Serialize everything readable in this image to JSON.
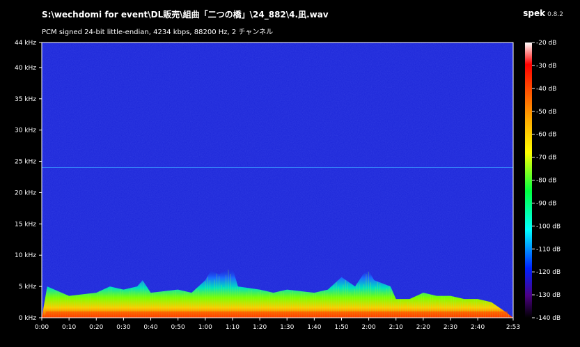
{
  "window": {
    "file_path": "S:\\wechdomi for event\\DL販売\\組曲「二つの橋」\\24_882\\4.凪.wav",
    "app_name": "spek",
    "app_version": "0.8.2",
    "file_info": "PCM signed 24-bit little-endian, 4234 kbps, 88200 Hz, 2 チャンネル"
  },
  "colors": {
    "background": "#000000",
    "spectrogram_base": "#1a24d8",
    "axis": "#ffffff",
    "scale": [
      "#ffffff",
      "#ff0000",
      "#ffa500",
      "#ffff00",
      "#00ff00",
      "#00ffff",
      "#0000ff",
      "#4b0082",
      "#000000"
    ]
  },
  "chart_data": {
    "type": "heatmap",
    "y_axis": {
      "unit": "kHz",
      "range": [
        0,
        44
      ],
      "ticks": [
        "0 kHz",
        "5 kHz",
        "10 kHz",
        "15 kHz",
        "20 kHz",
        "25 kHz",
        "30 kHz",
        "35 kHz",
        "40 kHz",
        "44 kHz"
      ],
      "tick_values": [
        0,
        5,
        10,
        15,
        20,
        25,
        30,
        35,
        40,
        44
      ]
    },
    "x_axis": {
      "unit": "time",
      "range_seconds": [
        0,
        173
      ],
      "ticks": [
        "0:00",
        "0:10",
        "0:20",
        "0:30",
        "0:40",
        "0:50",
        "1:00",
        "1:10",
        "1:20",
        "1:30",
        "1:40",
        "1:50",
        "2:00",
        "2:10",
        "2:20",
        "2:30",
        "2:40",
        "2:53"
      ],
      "tick_values": [
        0,
        10,
        20,
        30,
        40,
        50,
        60,
        70,
        80,
        90,
        100,
        110,
        120,
        130,
        140,
        150,
        160,
        173
      ]
    },
    "color_scale": {
      "unit": "dB",
      "range": [
        -140,
        -20
      ],
      "ticks": [
        "-20 dB",
        "-30 dB",
        "-40 dB",
        "-50 dB",
        "-60 dB",
        "-70 dB",
        "-80 dB",
        "-90 dB",
        "-100 dB",
        "-110 dB",
        "-120 dB",
        "-130 dB",
        "-140 dB"
      ],
      "tick_values": [
        -20,
        -30,
        -40,
        -50,
        -60,
        -70,
        -80,
        -90,
        -100,
        -110,
        -120,
        -130,
        -140
      ]
    },
    "noise_floor_line_khz": 24,
    "energy_envelope": {
      "time_seconds": [
        0,
        2,
        10,
        20,
        25,
        30,
        35,
        37,
        40,
        50,
        55,
        60,
        62,
        65,
        70,
        72,
        80,
        85,
        90,
        100,
        105,
        110,
        115,
        118,
        120,
        122,
        125,
        128,
        130,
        135,
        140,
        145,
        150,
        155,
        160,
        165,
        170,
        173
      ],
      "max_khz": [
        0,
        5,
        3.5,
        4,
        5,
        4.5,
        5,
        6,
        4,
        4.5,
        4,
        6,
        7.5,
        7,
        8,
        5,
        4.5,
        4,
        4.5,
        4,
        4.5,
        6.5,
        5,
        7,
        7.5,
        6,
        5.5,
        5,
        3,
        3,
        4,
        3.5,
        3.5,
        3,
        3,
        2.5,
        1,
        0
      ]
    }
  }
}
